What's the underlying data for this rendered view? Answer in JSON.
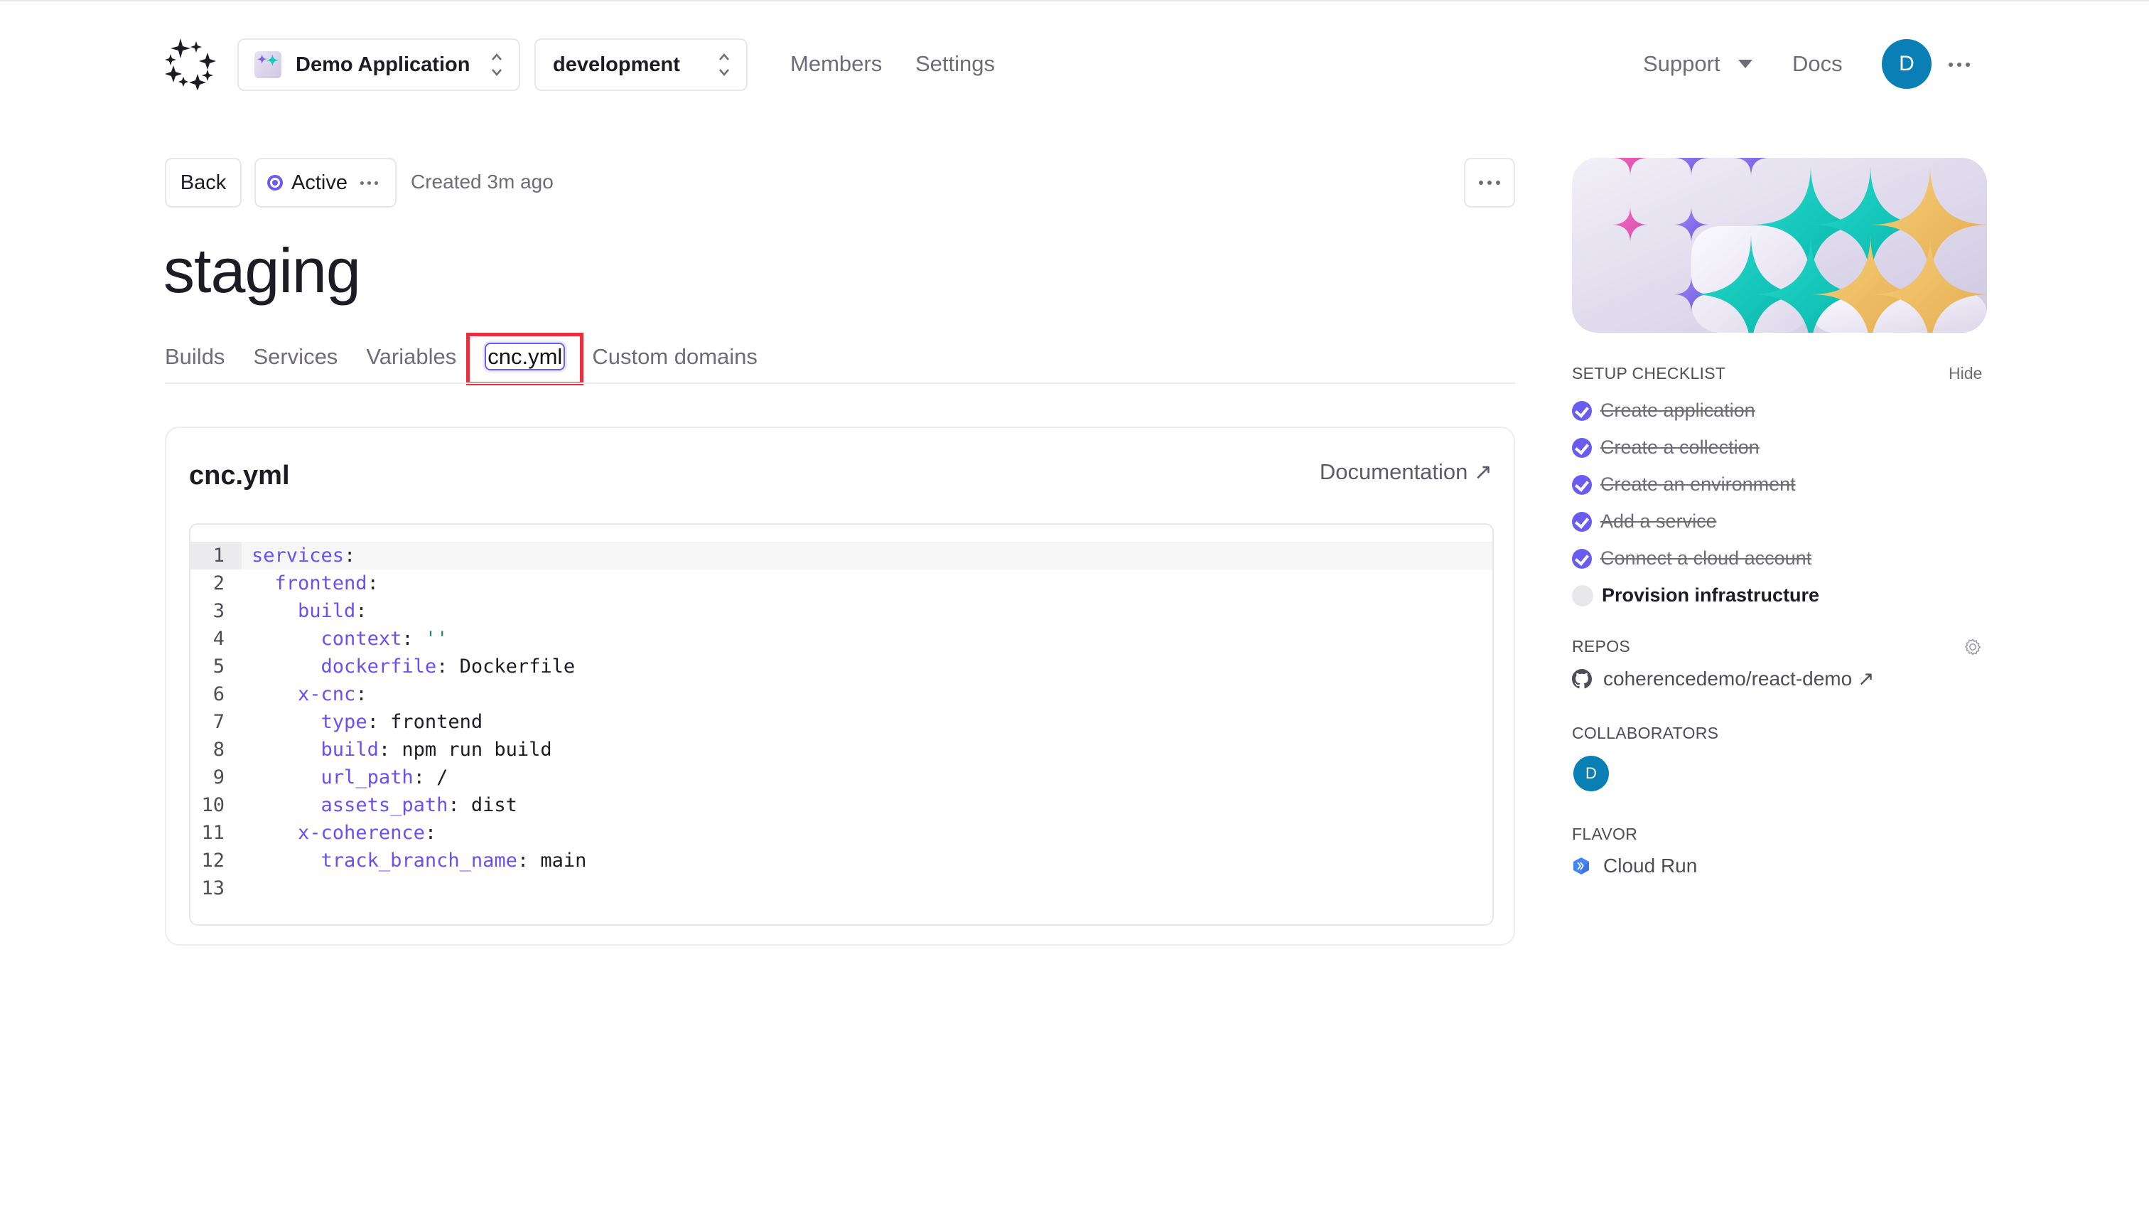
{
  "header": {
    "app_select": {
      "label": "Demo Application"
    },
    "env_select": {
      "label": "development"
    },
    "nav": [
      {
        "label": "Members"
      },
      {
        "label": "Settings"
      }
    ],
    "support_label": "Support",
    "docs_label": "Docs",
    "user_initial": "D"
  },
  "env": {
    "back_label": "Back",
    "status_label": "Active",
    "created_text": "Created 3m ago",
    "title": "staging"
  },
  "tabs": [
    {
      "label": "Builds",
      "active": false
    },
    {
      "label": "Services",
      "active": false
    },
    {
      "label": "Variables",
      "active": false
    },
    {
      "label": "cnc.yml",
      "active": true
    },
    {
      "label": "Custom domains",
      "active": false
    }
  ],
  "card": {
    "title": "cnc.yml",
    "doc_link": "Documentation ↗"
  },
  "code": {
    "lines": [
      {
        "n": "1",
        "indent": "",
        "key": "services",
        "sep": ":",
        "val": ""
      },
      {
        "n": "2",
        "indent": "  ",
        "key": "frontend",
        "sep": ":",
        "val": ""
      },
      {
        "n": "3",
        "indent": "    ",
        "key": "build",
        "sep": ":",
        "val": ""
      },
      {
        "n": "4",
        "indent": "      ",
        "key": "context",
        "sep": ": ",
        "val": "''",
        "str": true
      },
      {
        "n": "5",
        "indent": "      ",
        "key": "dockerfile",
        "sep": ": ",
        "val": "Dockerfile"
      },
      {
        "n": "6",
        "indent": "    ",
        "key": "x-cnc",
        "sep": ":",
        "val": ""
      },
      {
        "n": "7",
        "indent": "      ",
        "key": "type",
        "sep": ": ",
        "val": "frontend"
      },
      {
        "n": "8",
        "indent": "      ",
        "key": "build",
        "sep": ": ",
        "val": "npm run build"
      },
      {
        "n": "9",
        "indent": "      ",
        "key": "url_path",
        "sep": ": ",
        "val": "/"
      },
      {
        "n": "10",
        "indent": "      ",
        "key": "assets_path",
        "sep": ": ",
        "val": "dist"
      },
      {
        "n": "11",
        "indent": "    ",
        "key": "x-coherence",
        "sep": ":",
        "val": ""
      },
      {
        "n": "12",
        "indent": "      ",
        "key": "track_branch_name",
        "sep": ": ",
        "val": "main"
      },
      {
        "n": "13",
        "indent": "",
        "key": "",
        "sep": "",
        "val": ""
      }
    ]
  },
  "sidebar": {
    "checklist_label": "SETUP CHECKLIST",
    "hide_label": "Hide",
    "checklist": [
      {
        "label": "Create application",
        "done": true
      },
      {
        "label": "Create a collection",
        "done": true
      },
      {
        "label": "Create an environment",
        "done": true
      },
      {
        "label": "Add a service",
        "done": true
      },
      {
        "label": "Connect a cloud account",
        "done": true
      },
      {
        "label": "Provision infrastructure",
        "done": false
      }
    ],
    "repos_label": "REPOS",
    "repo": "coherencedemo/react-demo ↗",
    "collaborators_label": "COLLABORATORS",
    "collaborator_initial": "D",
    "flavor_label": "FLAVOR",
    "flavor": "Cloud Run"
  },
  "colors": {
    "accent": "#6b5cf0",
    "avatar": "#0a7fb5",
    "highlight_box": "#e8303f",
    "code_key": "#6b4ff0"
  }
}
